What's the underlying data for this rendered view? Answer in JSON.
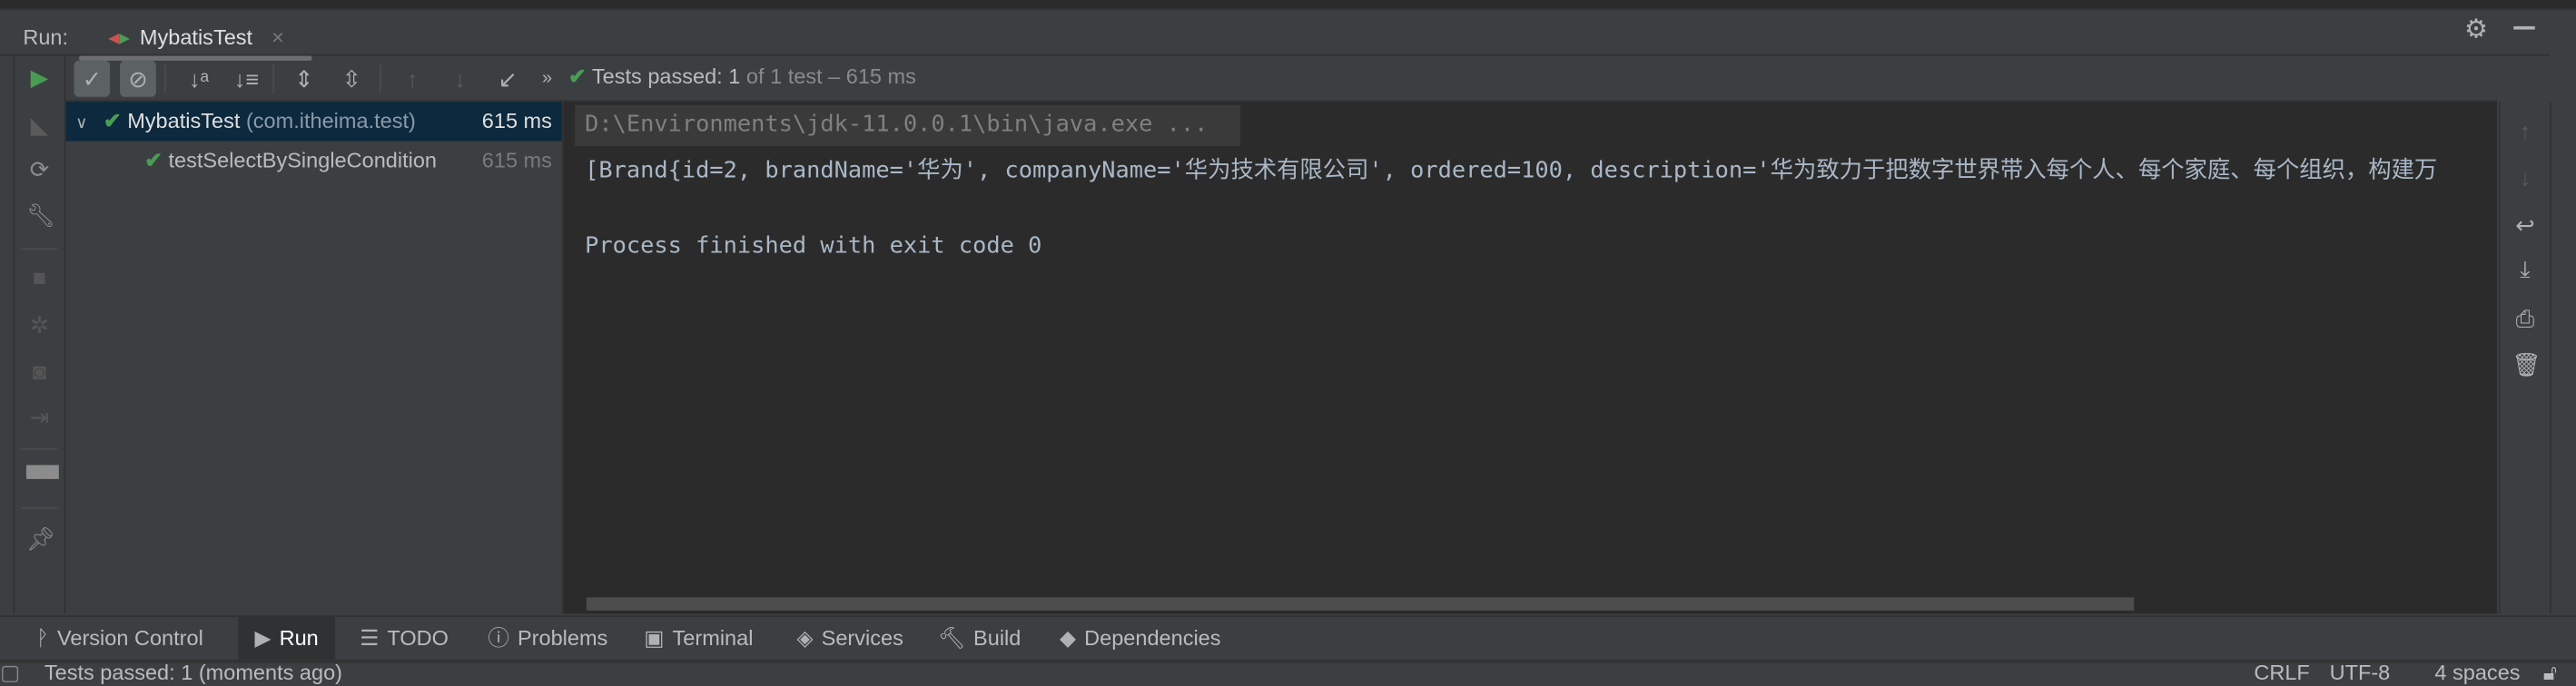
{
  "run_panel": {
    "label": "Run:",
    "tab": {
      "title": "MybatisTest",
      "icon": "junit-run-icon",
      "close_icon": "close-icon"
    },
    "header_icons": [
      "gear-icon",
      "minimize-icon"
    ]
  },
  "toolbar": {
    "buttons": [
      "show-passed-icon",
      "show-ignored-icon",
      "sort-alphabetically-icon",
      "sort-by-duration-icon",
      "expand-all-icon",
      "collapse-all-icon",
      "previous-failed-icon",
      "next-failed-icon",
      "import-tests-icon",
      "more-icon"
    ],
    "status": {
      "prefix": "Tests passed:",
      "count": "1",
      "suffix": "of 1 test – 615 ms"
    }
  },
  "left_actions": [
    "rerun-icon",
    "rerun-failed-icon",
    "toggle-auto-test-icon",
    "settings-wrench-icon",
    "stop-icon",
    "debug-exception-icon",
    "snapshot-icon",
    "export-icon",
    "layout-icon",
    "pin-icon"
  ],
  "tree": {
    "items": [
      {
        "name": "MybatisTest",
        "package": "(com.itheima.test)",
        "duration": "615 ms",
        "status": "passed",
        "selected": true,
        "expanded": true
      },
      {
        "name": "testSelectBySingleCondition",
        "duration": "615 ms",
        "status": "passed"
      }
    ]
  },
  "console": {
    "lines": [
      "D:\\Environments\\jdk-11.0.0.1\\bin\\java.exe ...",
      "[Brand{id=2, brandName='华为', companyName='华为技术有限公司', ordered=100, description='华为致力于把数字世界带入每个人、每个家庭、每个组织，构建万",
      "",
      "Process finished with exit code 0"
    ]
  },
  "right_actions": [
    "scroll-up-icon",
    "scroll-down-icon",
    "soft-wrap-icon",
    "scroll-to-end-icon",
    "print-icon",
    "clear-all-icon"
  ],
  "bottom_tabs": [
    {
      "label": "Version Control",
      "icon": "vcs-icon"
    },
    {
      "label": "Run",
      "icon": "run-icon",
      "active": true
    },
    {
      "label": "TODO",
      "icon": "todo-icon"
    },
    {
      "label": "Problems",
      "icon": "problems-icon"
    },
    {
      "label": "Terminal",
      "icon": "terminal-icon"
    },
    {
      "label": "Services",
      "icon": "services-icon"
    },
    {
      "label": "Build",
      "icon": "build-icon"
    },
    {
      "label": "Dependencies",
      "icon": "dependencies-icon"
    }
  ],
  "status_bar": {
    "message": "Tests passed: 1 (moments ago)",
    "line_separator": "CRLF",
    "encoding": "UTF-8",
    "indent": "4 spaces"
  },
  "colors": {
    "passed": "#499c54",
    "selection": "#0d293e",
    "console_bg": "#2b2b2b",
    "panel_bg": "#3c3f41"
  }
}
